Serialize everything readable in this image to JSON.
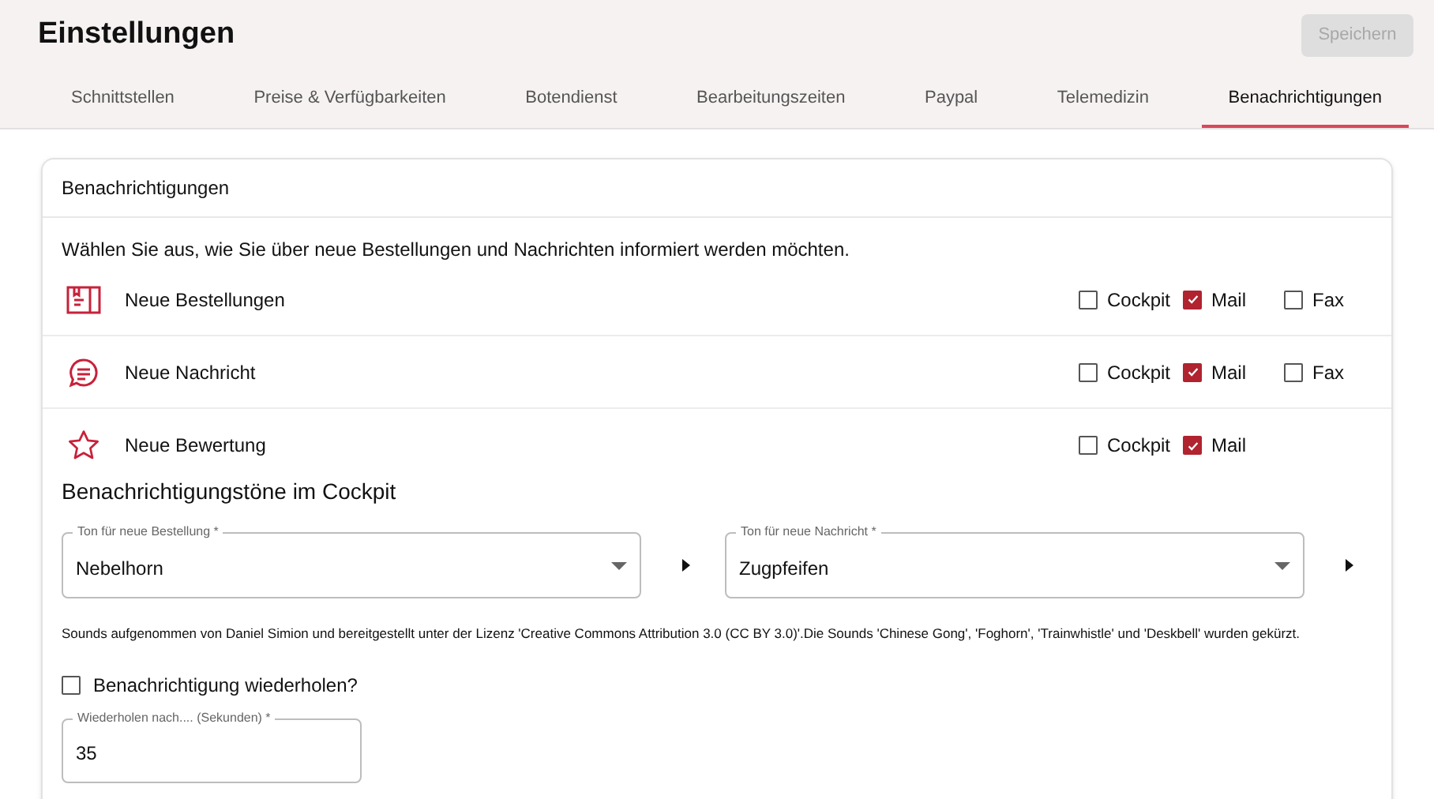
{
  "header": {
    "title": "Einstellungen",
    "save_button": {
      "label": "Speichern",
      "disabled": true
    }
  },
  "tabs": [
    {
      "label": "Schnittstellen",
      "selected": false
    },
    {
      "label": "Preise & Verfügbarkeiten",
      "selected": false
    },
    {
      "label": "Botendienst",
      "selected": false
    },
    {
      "label": "Bearbeitungszeiten",
      "selected": false
    },
    {
      "label": "Paypal",
      "selected": false
    },
    {
      "label": "Telemedizin",
      "selected": false
    },
    {
      "label": "Benachrichtigungen",
      "selected": true
    }
  ],
  "card": {
    "title": "Benachrichtigungen",
    "intro": "Wählen Sie aus, wie Sie über neue Bestellungen und Nachrichten informiert werden möchten.",
    "rows": [
      {
        "kind": "orders",
        "label": "Neue Bestellungen",
        "options": [
          {
            "label": "Cockpit",
            "checked": false
          },
          {
            "label": "Mail",
            "checked": true
          },
          {
            "label": "Fax",
            "checked": false
          }
        ]
      },
      {
        "kind": "message",
        "label": "Neue Nachricht",
        "options": [
          {
            "label": "Cockpit",
            "checked": false
          },
          {
            "label": "Mail",
            "checked": true
          },
          {
            "label": "Fax",
            "checked": false
          }
        ]
      },
      {
        "kind": "star",
        "label": "Neue Bewertung",
        "options": [
          {
            "label": "Cockpit",
            "checked": false
          },
          {
            "label": "Mail",
            "checked": true
          }
        ]
      }
    ],
    "sounds_heading": "Benachrichtigungstöne im Cockpit",
    "sound_selects": [
      {
        "label": "Ton für neue Bestellung *",
        "value": "Nebelhorn"
      },
      {
        "label": "Ton für neue Nachricht *",
        "value": "Zugpfeifen"
      }
    ],
    "credits": "Sounds aufgenommen von Daniel Simion und bereitgestellt unter der Lizenz 'Creative Commons Attribution 3.0 (CC BY 3.0)'.Die Sounds 'Chinese Gong', 'Foghorn', 'Trainwhistle' und 'Deskbell' wurden gekürzt.",
    "repeat": {
      "label": "Benachrichtigung wiederholen?",
      "checked": false
    },
    "repeat_field": {
      "label": "Wiederholen nach.... (Sekunden) *",
      "value": "35"
    }
  }
}
